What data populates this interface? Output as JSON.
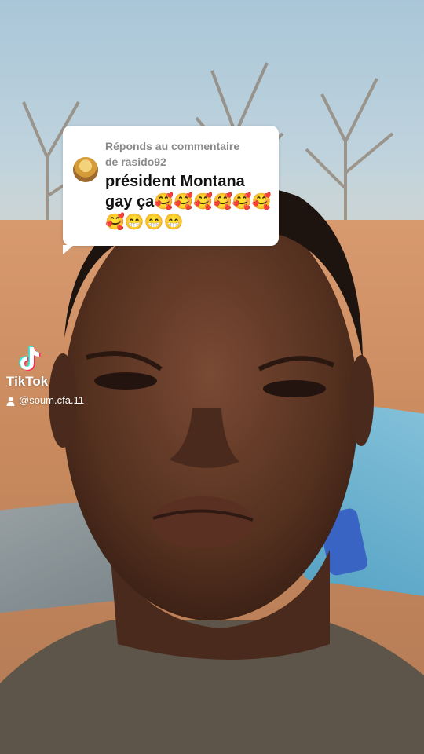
{
  "comment": {
    "reply_label": "Réponds au commentaire",
    "reply_user": "de rasido92",
    "text": "président Montana gay ça🥰🥰🥰🥰🥰🥰🥰😁😁😁"
  },
  "watermark": {
    "app_name": "TikTok",
    "handle": "@soum.cfa.11"
  },
  "icons": [
    "tiktok-logo-icon",
    "user-icon",
    "avatar-icon"
  ],
  "colors": {
    "bubble": "#ffffff",
    "reply_label": "#8a8a8a",
    "comment_text": "#111111",
    "watermark_text": "#ffffff"
  }
}
